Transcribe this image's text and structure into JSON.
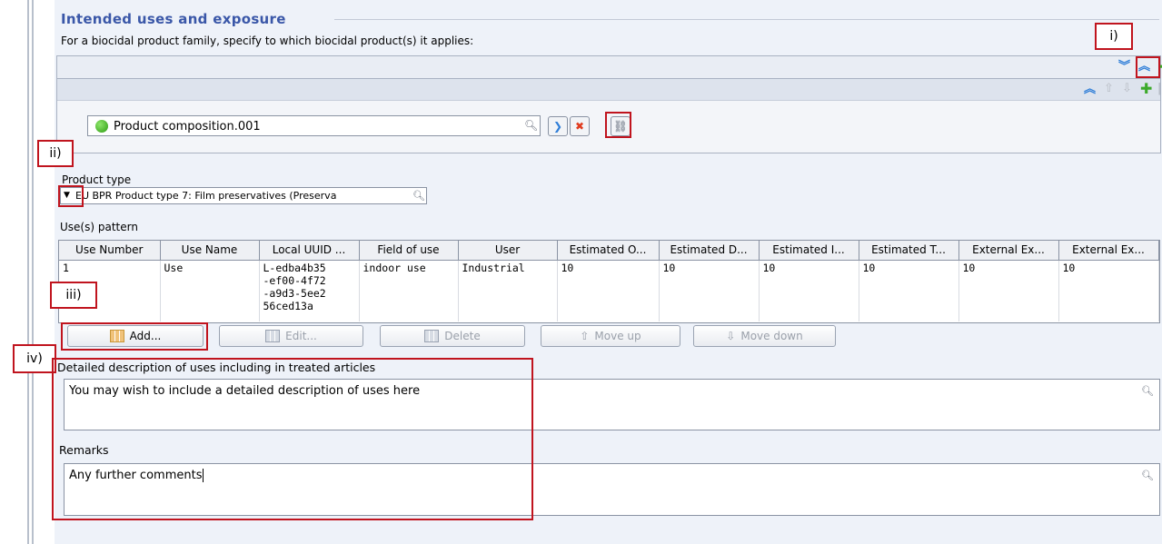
{
  "section": {
    "title": "Intended uses and exposure",
    "instruction": "For a biocidal product family, specify to which biocidal product(s) it applies:"
  },
  "callouts": {
    "i": "i)",
    "ii": "ii)",
    "iii": "iii)",
    "iv": "iv)"
  },
  "toolbar_top": {
    "expand_all_icon": "double-chevron-down-icon",
    "collapse_all_icon": "double-chevron-up-icon",
    "add_icon": "plus-icon"
  },
  "toolbar_block": {
    "icons": [
      "double-chevron-up-icon",
      "arrow-up-icon",
      "arrow-down-icon",
      "plus-icon",
      "remove-icon"
    ]
  },
  "reference": {
    "value": "Product composition.001"
  },
  "product_type": {
    "label": "Product type",
    "value": "EU BPR Product type 7: Film preservatives (Preserva"
  },
  "uses": {
    "label": "Use(s) pattern",
    "columns": [
      "Use Number",
      "Use Name",
      "Local UUID ...",
      "Field of use",
      "User",
      "Estimated O...",
      "Estimated D...",
      "Estimated I...",
      "Estimated T...",
      "External Ex...",
      "External Ex..."
    ],
    "rows": [
      [
        "1",
        "Use",
        "L-edba4b35\n-ef00-4f72\n-a9d3-5ee2\n56ced13a",
        "indoor use",
        "Industrial",
        "10",
        "10",
        "10",
        "10",
        "10",
        "10"
      ]
    ]
  },
  "buttons": {
    "add": "Add...",
    "edit": "Edit...",
    "delete": "Delete",
    "move_up": "Move up",
    "move_down": "Move down"
  },
  "detailed_description": {
    "label": "Detailed description of uses including in treated articles",
    "value": "You may wish to include a detailed description of uses here"
  },
  "remarks": {
    "label": "Remarks",
    "value": "Any further comments"
  },
  "colors": {
    "title": "#3a57a8",
    "callout_border": "#c0141e",
    "panel_bg": "#eef2f9"
  }
}
